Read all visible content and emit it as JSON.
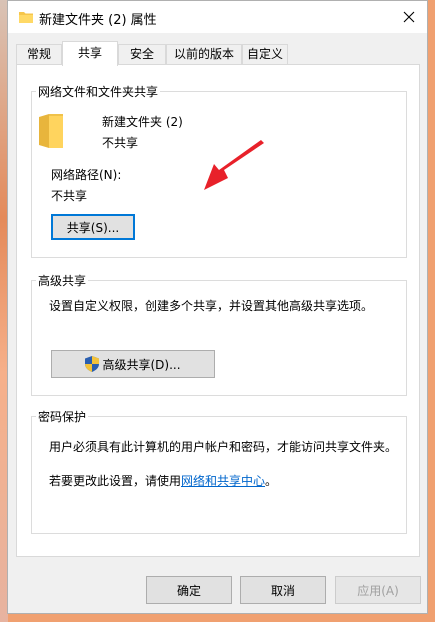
{
  "window": {
    "title": "新建文件夹 (2) 属性",
    "folder_icon": "folder-icon",
    "close_icon": "close-icon"
  },
  "tabs": [
    {
      "label": "常规"
    },
    {
      "label": "共享",
      "active": true
    },
    {
      "label": "安全"
    },
    {
      "label": "以前的版本"
    },
    {
      "label": "自定义"
    }
  ],
  "network_sharing": {
    "legend": "网络文件和文件夹共享",
    "folder_name": "新建文件夹 (2)",
    "share_status": "不共享",
    "path_label": "网络路径(N):",
    "path_value": "不共享",
    "share_button": "共享(S)..."
  },
  "advanced_sharing": {
    "legend": "高级共享",
    "description": "设置自定义权限，创建多个共享，并设置其他高级共享选项。",
    "button": "高级共享(D)...",
    "shield_icon": "uac-shield-icon"
  },
  "password_protection": {
    "legend": "密码保护",
    "description": "用户必须具有此计算机的用户帐户和密码，才能访问共享文件夹。",
    "change_prefix": "若要更改此设置，请使用",
    "link_text": "网络和共享中心",
    "change_suffix": "。"
  },
  "footer": {
    "ok": "确定",
    "cancel": "取消",
    "apply": "应用(A)"
  },
  "colors": {
    "accent": "#0078d7",
    "annotation_arrow": "#e8212a",
    "link": "#0066cc"
  }
}
